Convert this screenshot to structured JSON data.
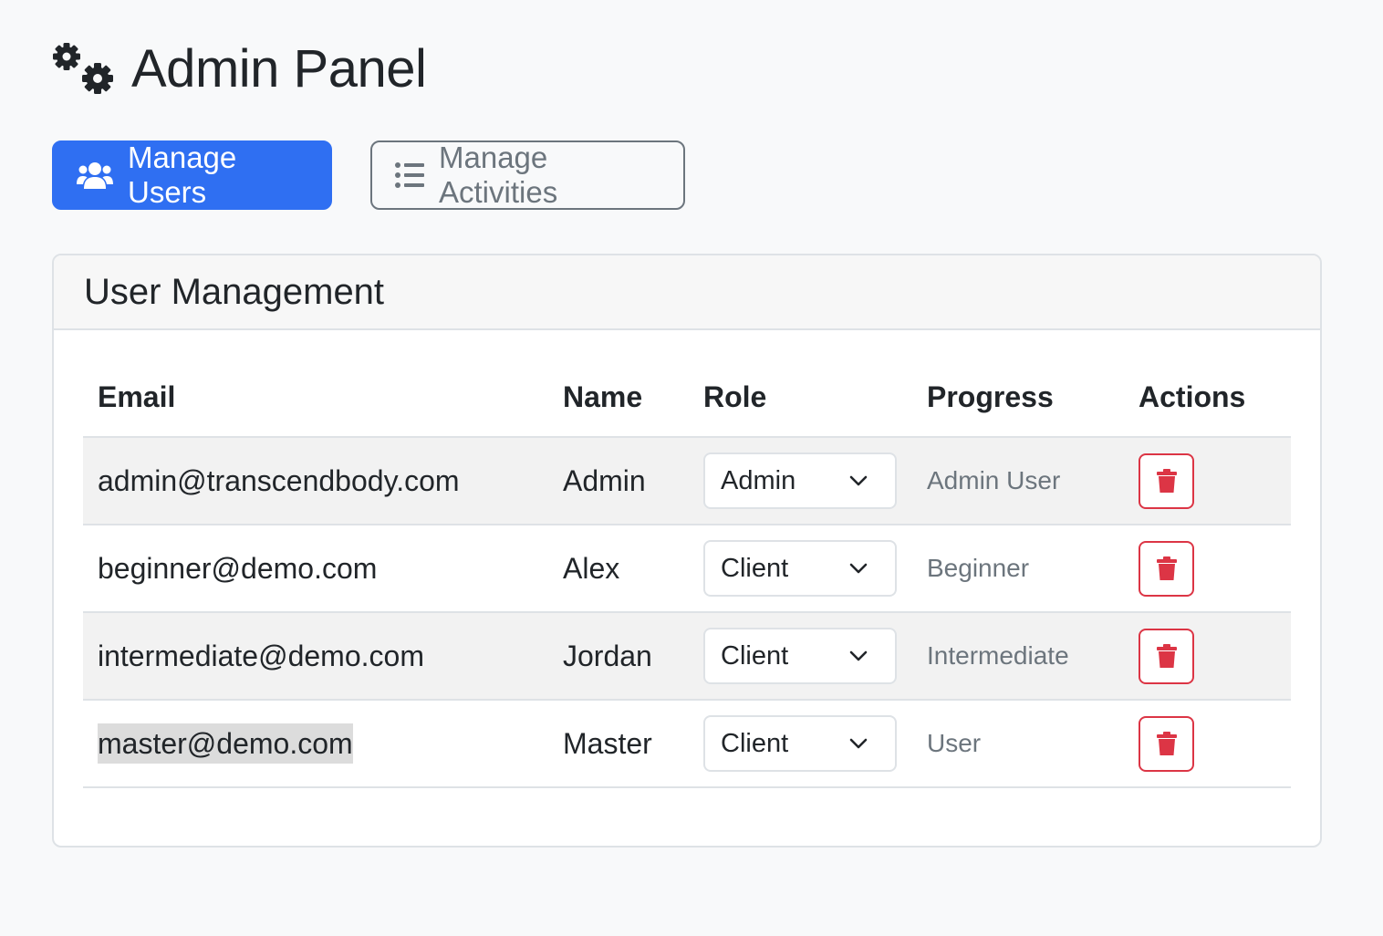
{
  "header": {
    "icon": "gears-icon",
    "title": "Admin Panel"
  },
  "tabs": [
    {
      "label": "Manage Users",
      "icon": "users-icon",
      "active": true
    },
    {
      "label": "Manage Activities",
      "icon": "list-icon",
      "active": false
    }
  ],
  "colors": {
    "primary": "#2f6ff2",
    "danger": "#dc3545",
    "muted": "#6c757d"
  },
  "user_management": {
    "title": "User Management",
    "columns": [
      "Email",
      "Name",
      "Role",
      "Progress",
      "Actions"
    ],
    "rows": [
      {
        "email": "admin@transcendbody.com",
        "name": "Admin",
        "role": "Admin",
        "progress": "Admin User",
        "action_icon": "trash-icon"
      },
      {
        "email": "beginner@demo.com",
        "name": "Alex",
        "role": "Client",
        "progress": "Beginner",
        "action_icon": "trash-icon"
      },
      {
        "email": "intermediate@demo.com",
        "name": "Jordan",
        "role": "Client",
        "progress": "Intermediate",
        "action_icon": "trash-icon"
      },
      {
        "email": "master@demo.com",
        "name": "Master",
        "role": "Client",
        "progress": "User",
        "action_icon": "trash-icon"
      }
    ]
  }
}
